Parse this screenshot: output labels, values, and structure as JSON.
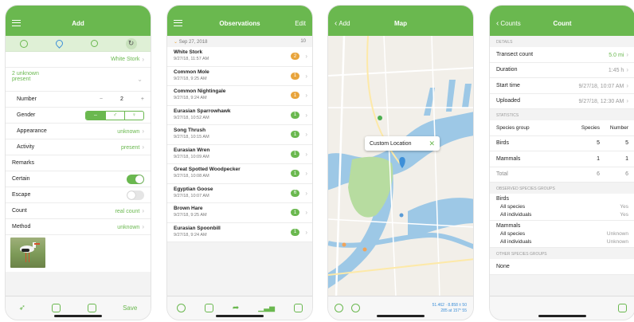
{
  "colors": {
    "brand": "#6ab84f",
    "badge_orange": "#e8a43c"
  },
  "screen1": {
    "title": "Add",
    "species": "White Stork",
    "unknown_line1": "2 unknown",
    "unknown_line2": "present",
    "rows": [
      {
        "label": "Number",
        "minus": "−",
        "value": "2",
        "plus": "+"
      },
      {
        "label": "Gender",
        "options": [
          "–",
          "♂",
          "♀"
        ]
      },
      {
        "label": "Appearance",
        "value": "unknown"
      },
      {
        "label": "Activity",
        "value": "present"
      }
    ],
    "remarks": "Remarks",
    "certain": "Certain",
    "escape": "Escape",
    "count_label": "Count",
    "count_value": "real count",
    "method_label": "Method",
    "method_value": "unknown",
    "save": "Save"
  },
  "screen2": {
    "title": "Observations",
    "edit": "Edit",
    "date": "Sep 27, 2018",
    "date_count": "10",
    "items": [
      {
        "name": "White Stork",
        "date": "9/27/18, 11:57 AM",
        "badge": "2",
        "color": "orange"
      },
      {
        "name": "Common Mole",
        "date": "9/27/18, 9:25 AM",
        "badge": "1",
        "color": "orange"
      },
      {
        "name": "Common Nightingale",
        "date": "9/27/18, 9:24 AM",
        "badge": "1",
        "color": "orange"
      },
      {
        "name": "Eurasian Sparrowhawk",
        "date": "9/27/18, 10:52 AM",
        "badge": "1",
        "color": "green"
      },
      {
        "name": "Song Thrush",
        "date": "9/27/18, 10:15 AM",
        "badge": "1",
        "color": "green"
      },
      {
        "name": "Eurasian Wren",
        "date": "9/27/18, 10:09 AM",
        "badge": "1",
        "color": "green"
      },
      {
        "name": "Great Spotted Woodpecker",
        "date": "9/27/18, 10:08 AM",
        "badge": "1",
        "color": "green"
      },
      {
        "name": "Egyptian Goose",
        "date": "9/27/18, 10:07 AM",
        "badge": "6",
        "color": "green"
      },
      {
        "name": "Brown Hare",
        "date": "9/27/18, 9:25 AM",
        "badge": "1",
        "color": "green"
      },
      {
        "name": "Eurasian Spoonbill",
        "date": "9/27/18, 9:24 AM",
        "badge": "1",
        "color": "green"
      }
    ]
  },
  "screen3": {
    "title": "Map",
    "back": "Add",
    "callout": "Custom Location",
    "coords_line1": "51.462 · 8.858 ± 50",
    "coords_line2": "285 at 157° 55"
  },
  "screen4": {
    "title": "Count",
    "back": "Counts",
    "details_header": "Details",
    "details": [
      {
        "label": "Transect count",
        "value": "5.0 mi",
        "green": true
      },
      {
        "label": "Duration",
        "value": "1:45 h"
      },
      {
        "label": "Start time",
        "value": "9/27/18, 10:07 AM"
      },
      {
        "label": "Uploaded",
        "value": "9/27/18, 12:30 AM"
      }
    ],
    "stats_header": "Statistics",
    "stats_cols": [
      "Species group",
      "Species",
      "Number"
    ],
    "stats": [
      {
        "g": "Birds",
        "s": "5",
        "n": "5"
      },
      {
        "g": "Mammals",
        "s": "1",
        "n": "1"
      },
      {
        "g": "Total",
        "s": "6",
        "n": "6"
      }
    ],
    "observed_header": "Observed species groups",
    "groups": [
      {
        "name": "Birds",
        "all_species": "Yes",
        "all_individuals": "Yes"
      },
      {
        "name": "Mammals",
        "all_species": "Unknown",
        "all_individuals": "Unknown"
      }
    ],
    "all_species_label": "All species",
    "all_individuals_label": "All individuals",
    "other_header": "Other species groups",
    "none": "None"
  }
}
